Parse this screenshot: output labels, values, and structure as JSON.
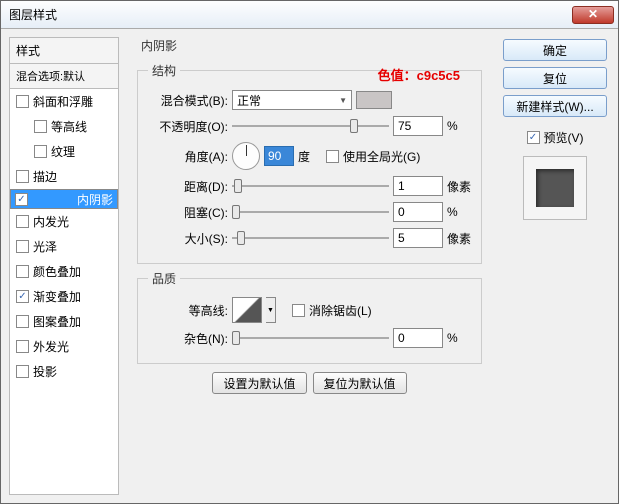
{
  "window": {
    "title": "图层样式"
  },
  "annotation": "色值：c9c5c5",
  "left": {
    "hdr": "样式",
    "hdr2": "混合选项:默认",
    "items": [
      {
        "label": "斜面和浮雕",
        "checked": false,
        "indent": false
      },
      {
        "label": "等高线",
        "checked": false,
        "indent": true
      },
      {
        "label": "纹理",
        "checked": false,
        "indent": true
      },
      {
        "label": "描边",
        "checked": false,
        "indent": false
      },
      {
        "label": "内阴影",
        "checked": true,
        "indent": false,
        "selected": true
      },
      {
        "label": "内发光",
        "checked": false,
        "indent": false
      },
      {
        "label": "光泽",
        "checked": false,
        "indent": false
      },
      {
        "label": "颜色叠加",
        "checked": false,
        "indent": false
      },
      {
        "label": "渐变叠加",
        "checked": true,
        "indent": false
      },
      {
        "label": "图案叠加",
        "checked": false,
        "indent": false
      },
      {
        "label": "外发光",
        "checked": false,
        "indent": false
      },
      {
        "label": "投影",
        "checked": false,
        "indent": false
      }
    ]
  },
  "mid": {
    "group_title": "内阴影",
    "structure_legend": "结构",
    "blend_label": "混合模式(B):",
    "blend_value": "正常",
    "opacity_label": "不透明度(O):",
    "opacity_value": "75",
    "pct": "%",
    "angle_label": "角度(A):",
    "angle_value": "90",
    "degree": "度",
    "global_light": "使用全局光(G)",
    "distance_label": "距离(D):",
    "distance_value": "1",
    "px": "像素",
    "choke_label": "阻塞(C):",
    "choke_value": "0",
    "size_label": "大小(S):",
    "size_value": "5",
    "quality_legend": "品质",
    "contour_label": "等高线:",
    "antialias": "消除锯齿(L)",
    "noise_label": "杂色(N):",
    "noise_value": "0",
    "btn_default": "设置为默认值",
    "btn_reset": "复位为默认值"
  },
  "right": {
    "ok": "确定",
    "cancel": "复位",
    "new_style": "新建样式(W)...",
    "preview": "预览(V)"
  }
}
